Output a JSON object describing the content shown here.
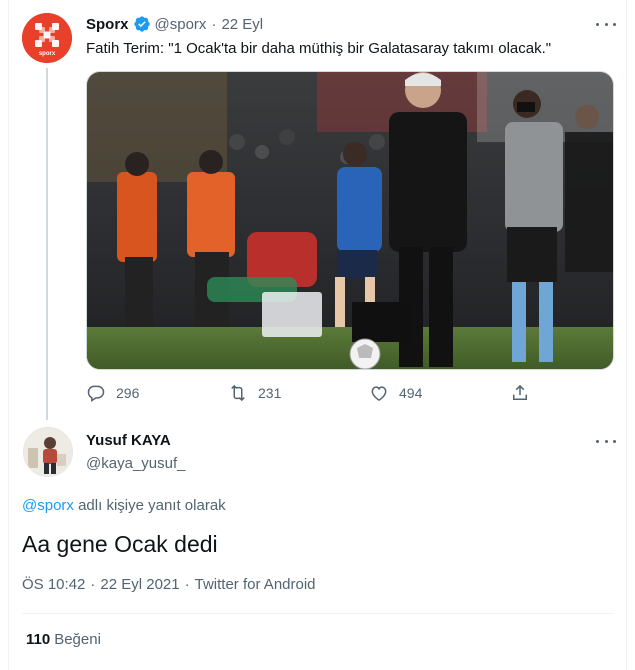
{
  "quoted_tweet": {
    "display_name": "Sporx",
    "handle": "@sporx",
    "date": "22 Eyl",
    "text": "Fatih Terim: \"1 Ocak'ta bir daha müthiş bir Galatasaray takımı olacak.\"",
    "avatar_text": "sporx",
    "replies": "296",
    "retweets": "231",
    "likes": "494",
    "accent_color": "#e8402b"
  },
  "reply_tweet": {
    "display_name": "Yusuf KAYA",
    "handle": "@kaya_yusuf_",
    "reply_to_handle": "@sporx",
    "reply_to_suffix": " adlı kişiye yanıt olarak",
    "text": "Aa gene Ocak dedi",
    "time": "ÖS 10:42",
    "date": "22 Eyl 2021",
    "client": "Twitter for Android",
    "like_count": "110",
    "like_label": "Beğeni"
  },
  "colors": {
    "link": "#1d9bf0",
    "verified": "#1d9bf0",
    "secondary_text": "#536471"
  }
}
